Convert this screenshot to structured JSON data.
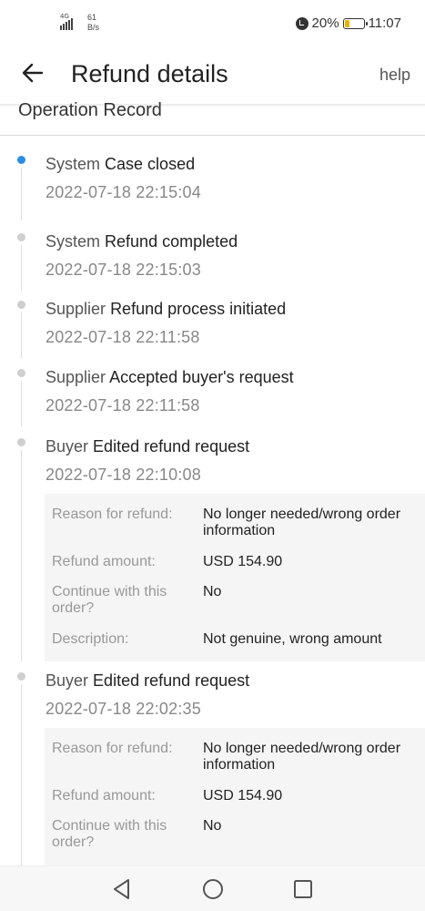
{
  "status_bar": {
    "network": "4G",
    "speed_value": "61",
    "speed_unit": "B/s",
    "battery": "20%",
    "time": "11:07"
  },
  "header": {
    "title": "Refund details",
    "help": "help"
  },
  "section": {
    "title": "Operation Record"
  },
  "timeline": [
    {
      "actor": "System",
      "action": "Case closed",
      "time": "2022-07-18 22:15:04",
      "active": true
    },
    {
      "actor": "System",
      "action": "Refund completed",
      "time": "2022-07-18 22:15:03"
    },
    {
      "actor": "Supplier",
      "action": "Refund process initiated",
      "time": "2022-07-18 22:11:58"
    },
    {
      "actor": "Supplier",
      "action": "Accepted buyer's request",
      "time": "2022-07-18 22:11:58"
    },
    {
      "actor": "Buyer",
      "action": "Edited refund request",
      "time": "2022-07-18 22:10:08",
      "details": [
        {
          "key": "Reason for refund:",
          "value": "No longer needed/wrong order information"
        },
        {
          "key": "Refund amount:",
          "value": "USD 154.90"
        },
        {
          "key": "Continue with this order?",
          "value": "No"
        },
        {
          "key": "Description:",
          "value": "Not genuine, wrong amount"
        }
      ]
    },
    {
      "actor": "Buyer",
      "action": "Edited refund request",
      "time": "2022-07-18 22:02:35",
      "details": [
        {
          "key": "Reason for refund:",
          "value": "No longer needed/wrong order information"
        },
        {
          "key": "Refund amount:",
          "value": "USD 154.90"
        },
        {
          "key": "Continue with this order?",
          "value": "No"
        }
      ]
    }
  ],
  "colors": {
    "active_dot": "#2b8ee0",
    "inactive_dot": "#cfcfcf",
    "detail_bg": "#f5f5f5"
  }
}
